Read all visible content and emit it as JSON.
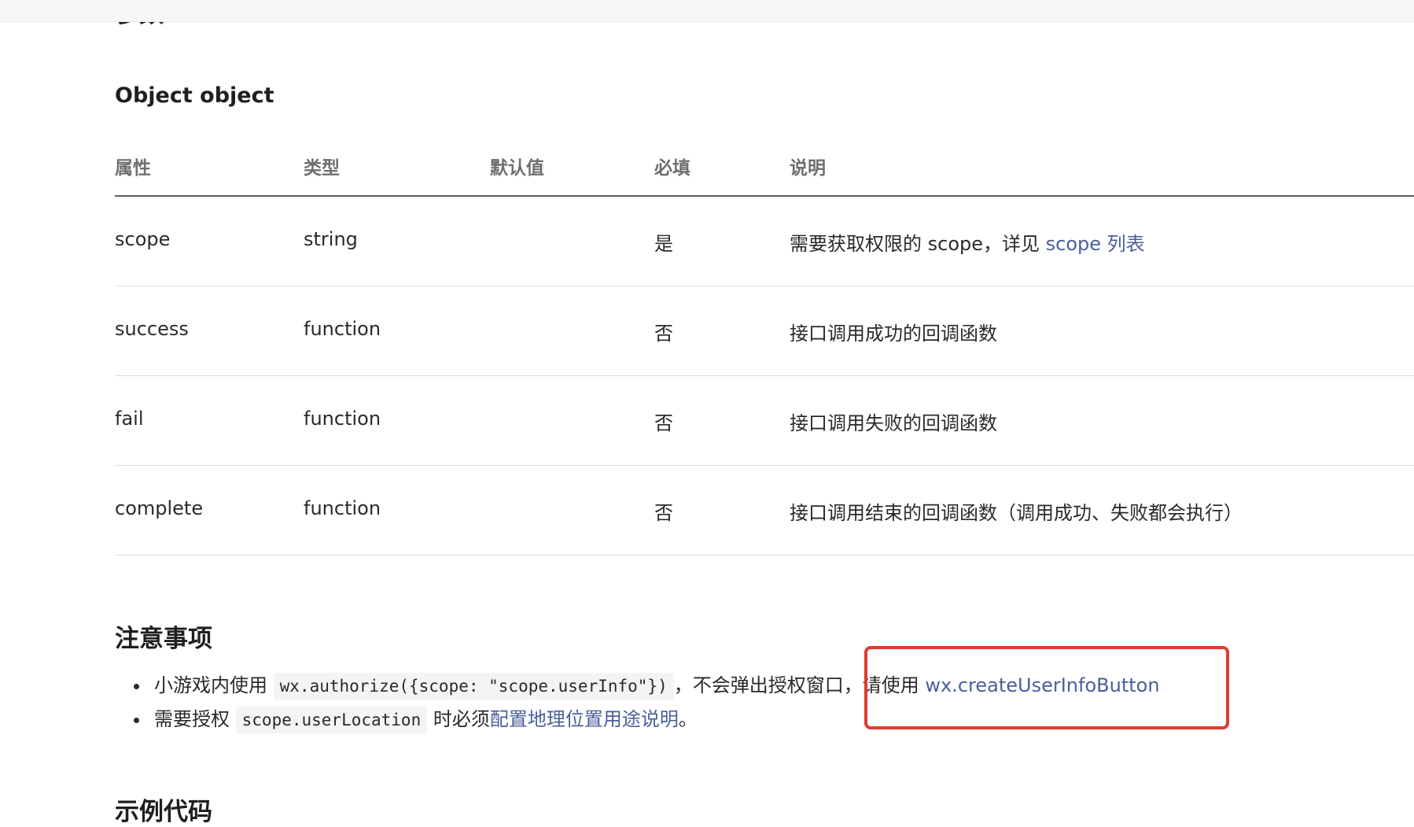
{
  "page": {
    "cut_heading": "参数",
    "object_heading": "Object object",
    "notes_heading": "注意事项",
    "example_heading": "示例代码"
  },
  "table": {
    "headers": [
      "属性",
      "类型",
      "默认值",
      "必填",
      "说明"
    ],
    "rows": [
      {
        "name": "scope",
        "type": "string",
        "default": "",
        "required": "是",
        "desc": "需要获取权限的 scope，详见 ",
        "desc_link": "scope 列表"
      },
      {
        "name": "success",
        "type": "function",
        "default": "",
        "required": "否",
        "desc": "接口调用成功的回调函数",
        "desc_link": ""
      },
      {
        "name": "fail",
        "type": "function",
        "default": "",
        "required": "否",
        "desc": "接口调用失败的回调函数",
        "desc_link": ""
      },
      {
        "name": "complete",
        "type": "function",
        "default": "",
        "required": "否",
        "desc": "接口调用结束的回调函数（调用成功、失败都会执行）",
        "desc_link": ""
      }
    ]
  },
  "notes": [
    {
      "pre": "小游戏内使用 ",
      "code": "wx.authorize({scope: \"scope.userInfo\"})",
      "mid": "，不会弹出授权窗口，请使用 ",
      "link": "wx.createUserInfoButton",
      "post": ""
    },
    {
      "pre": "需要授权 ",
      "code": "scope.userLocation",
      "mid": " 时必须",
      "link": "配置地理位置用途说明",
      "post": "。"
    }
  ],
  "colors": {
    "link": "#4a5f9a",
    "highlight": "#e03a2f"
  }
}
